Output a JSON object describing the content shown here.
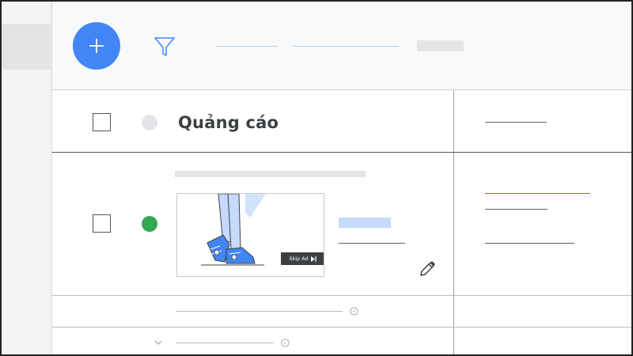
{
  "toolbar": {
    "add_icon": "plus-icon",
    "filter_icon": "filter-icon",
    "accent_color": "#4285f4"
  },
  "table": {
    "rows": [
      {
        "name": "Quảng cáo",
        "status_color": "#e3e5e8"
      },
      {
        "status_color": "#34a853",
        "ad_preview": {
          "skip_label": "Skip Ad"
        },
        "edit_icon": "pencil-icon"
      }
    ],
    "footer_rows": [
      {
        "icon": "help-icon"
      },
      {
        "expand_icon": "chevron-down-icon",
        "icon": "help-icon"
      }
    ]
  },
  "colors": {
    "active_status": "#34a853",
    "inactive_status": "#e3e5e8",
    "error_line": "#ea4335",
    "headline_placeholder": "#c6dafc"
  }
}
